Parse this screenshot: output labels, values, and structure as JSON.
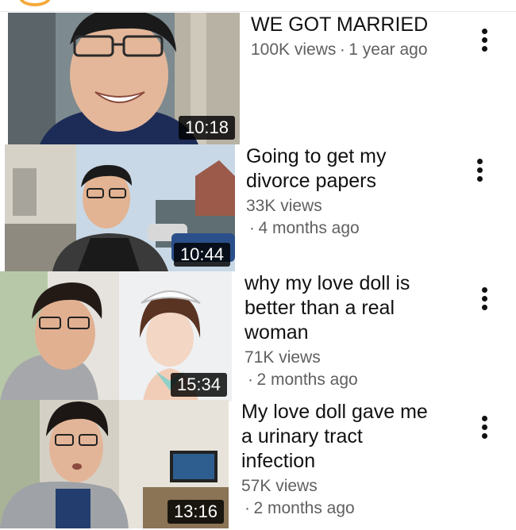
{
  "videos": [
    {
      "title": "WE GOT MARRIED",
      "views": "100K views",
      "separator": "·",
      "age": "1 year ago",
      "duration": "10:18"
    },
    {
      "title_line1": "Going to get my",
      "title_line2": "divorce papers",
      "views": "33K views",
      "separator": "·",
      "age": "4 months ago",
      "duration": "10:44"
    },
    {
      "title_line1": "why my love doll is",
      "title_line2": "better than a real",
      "title_line3": "woman",
      "views": "71K views",
      "separator": "·",
      "age": "2 months ago",
      "duration": "15:34"
    },
    {
      "title_line1": "My love doll gave me",
      "title_line2": "a urinary tract",
      "title_line3": "infection",
      "views": "57K views",
      "separator": "·",
      "age": "2 months ago",
      "duration": "13:16"
    }
  ]
}
